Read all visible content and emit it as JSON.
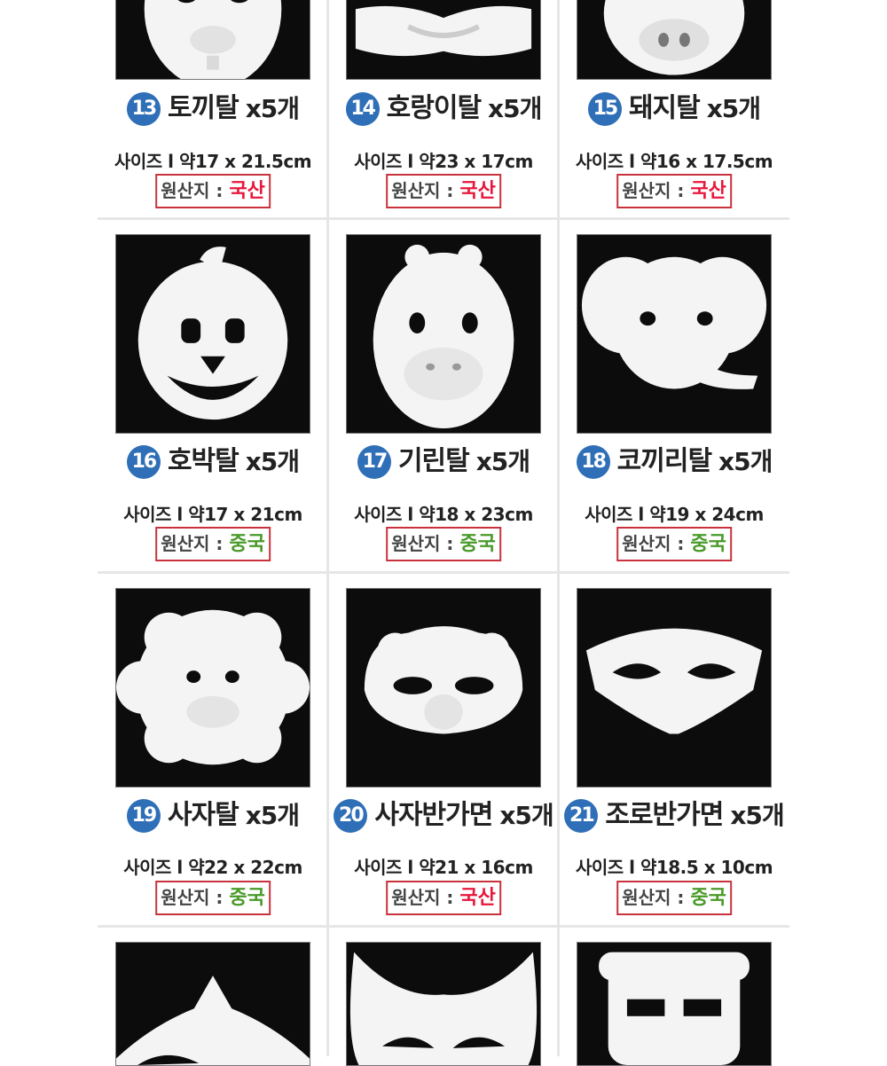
{
  "items": [
    {
      "num": "13",
      "name": "토끼탈",
      "qty": "x5개",
      "size_label": "사이즈 l",
      "size_value": "약17 x 21.5cm",
      "origin_label": "원산지 :",
      "origin_value": "국산",
      "origin_color": "#e8173c",
      "icon": "rabbit-mask"
    },
    {
      "num": "14",
      "name": "호랑이탈",
      "qty": "x5개",
      "size_label": "사이즈 l",
      "size_value": "약23 x 17cm",
      "origin_label": "원산지 :",
      "origin_value": "국산",
      "origin_color": "#e8173c",
      "icon": "tiger-mask"
    },
    {
      "num": "15",
      "name": "돼지탈",
      "qty": "x5개",
      "size_label": "사이즈 l",
      "size_value": "약16 x 17.5cm",
      "origin_label": "원산지 :",
      "origin_value": "국산",
      "origin_color": "#e8173c",
      "icon": "pig-mask"
    },
    {
      "num": "16",
      "name": "호박탈",
      "qty": "x5개",
      "size_label": "사이즈 l",
      "size_value": "약17 x 21cm",
      "origin_label": "원산지 :",
      "origin_value": "중국",
      "origin_color": "#4a9a2a",
      "icon": "pumpkin-mask"
    },
    {
      "num": "17",
      "name": "기린탈",
      "qty": "x5개",
      "size_label": "사이즈 l",
      "size_value": "약18 x 23cm",
      "origin_label": "원산지 :",
      "origin_value": "중국",
      "origin_color": "#4a9a2a",
      "icon": "giraffe-mask"
    },
    {
      "num": "18",
      "name": "코끼리탈",
      "qty": "x5개",
      "size_label": "사이즈 l",
      "size_value": "약19 x 24cm",
      "origin_label": "원산지 :",
      "origin_value": "중국",
      "origin_color": "#4a9a2a",
      "icon": "elephant-mask"
    },
    {
      "num": "19",
      "name": "사자탈",
      "qty": "x5개",
      "size_label": "사이즈 l",
      "size_value": "약22 x 22cm",
      "origin_label": "원산지 :",
      "origin_value": "중국",
      "origin_color": "#4a9a2a",
      "icon": "lion-mask"
    },
    {
      "num": "20",
      "name": "사자반가면",
      "qty": "x5개",
      "size_label": "사이즈 l",
      "size_value": "약21 x 16cm",
      "origin_label": "원산지 :",
      "origin_value": "국산",
      "origin_color": "#e8173c",
      "icon": "lion-half-mask"
    },
    {
      "num": "21",
      "name": "조로반가면",
      "qty": "x5개",
      "size_label": "사이즈 l",
      "size_value": "약18.5 x 10cm",
      "origin_label": "원산지 :",
      "origin_value": "중국",
      "origin_color": "#4a9a2a",
      "icon": "zorro-half-mask"
    }
  ],
  "partial_row_icons": [
    "crown-half-mask",
    "cat-half-mask",
    "warrior-mask"
  ],
  "colors": {
    "badge": "#2f6fb7",
    "origin_domestic": "#e8173c",
    "origin_china": "#4a9a2a",
    "origin_border": "#c9323c",
    "divider": "#e6e6e6"
  }
}
